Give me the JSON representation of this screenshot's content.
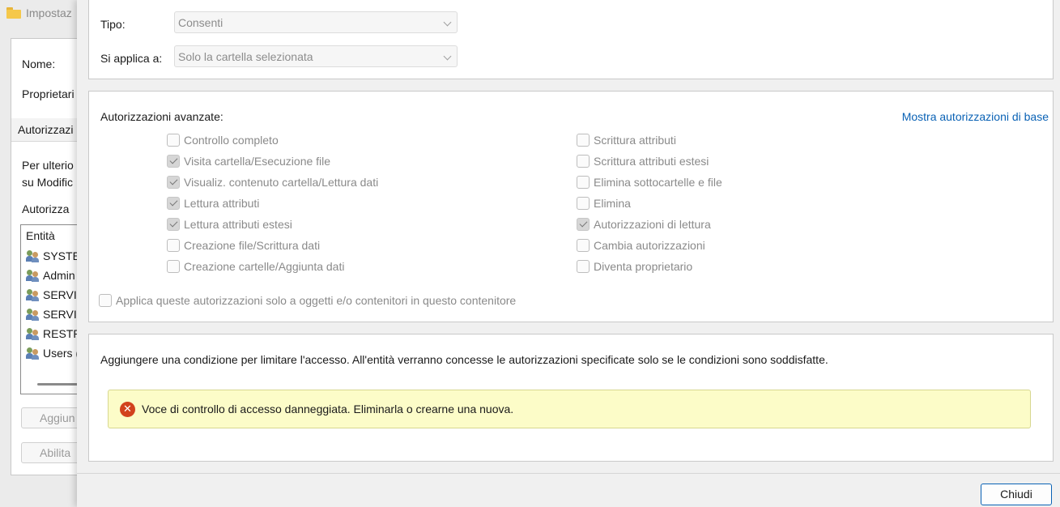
{
  "background_window": {
    "title": "Impostaz",
    "name_label": "Nome:",
    "owner_label": "Proprietari",
    "tab_label": "Autorizzazi",
    "info_line1": "Per ulterio",
    "info_line2": "su Modific",
    "perm_label": "Autorizza",
    "list_header": "Entità",
    "list_items": [
      "SYSTEM",
      "Admin",
      "SERVIZ",
      "SERVIZ",
      "RESTR",
      "Users ("
    ],
    "add_button": "Aggiun",
    "enable_button": "Abilita"
  },
  "dialog": {
    "type_label": "Tipo:",
    "type_value": "Consenti",
    "applies_label": "Si applica a:",
    "applies_value": "Solo la cartella selezionata",
    "advanced_title": "Autorizzazioni avanzate:",
    "basic_link": "Mostra autorizzazioni di base",
    "permissions_left": [
      {
        "label": "Controllo completo",
        "checked": false
      },
      {
        "label": "Visita cartella/Esecuzione file",
        "checked": true
      },
      {
        "label": "Visualiz. contenuto cartella/Lettura dati",
        "checked": true
      },
      {
        "label": "Lettura attributi",
        "checked": true
      },
      {
        "label": "Lettura attributi estesi",
        "checked": true
      },
      {
        "label": "Creazione file/Scrittura dati",
        "checked": false
      },
      {
        "label": "Creazione cartelle/Aggiunta dati",
        "checked": false
      }
    ],
    "permissions_right": [
      {
        "label": "Scrittura attributi",
        "checked": false
      },
      {
        "label": "Scrittura attributi estesi",
        "checked": false
      },
      {
        "label": "Elimina sottocartelle e file",
        "checked": false
      },
      {
        "label": "Elimina",
        "checked": false
      },
      {
        "label": "Autorizzazioni di lettura",
        "checked": true
      },
      {
        "label": "Cambia autorizzazioni",
        "checked": false
      },
      {
        "label": "Diventa proprietario",
        "checked": false
      }
    ],
    "apply_only_label": "Applica queste autorizzazioni solo a oggetti e/o contenitori in questo contenitore",
    "condition_text": "Aggiungere una condizione per limitare l'accesso. All'entità verranno concesse le autorizzazioni specificate solo se le condizioni sono soddisfatte.",
    "warning_text": "Voce di controllo di accesso danneggiata. Eliminarla o crearne una nuova.",
    "warning_icon": "error-icon",
    "close_button": "Chiudi"
  },
  "colors": {
    "link": "#0a62b5",
    "warning_bg": "#fcfcc8",
    "error": "#d2421d"
  }
}
